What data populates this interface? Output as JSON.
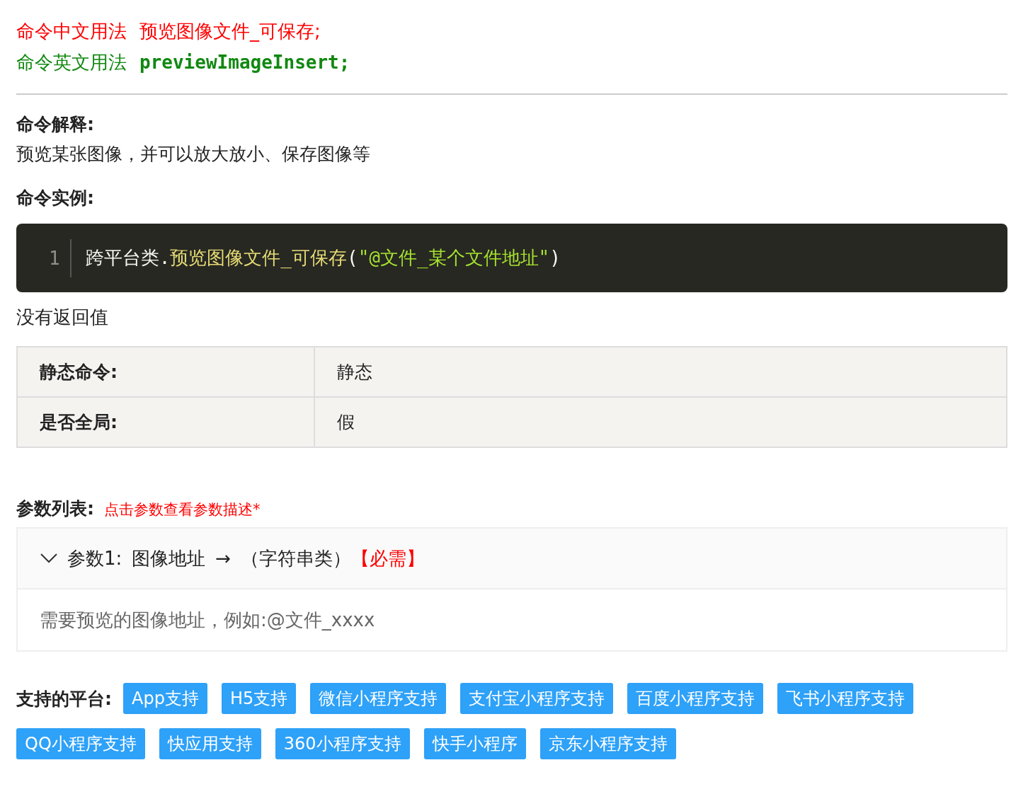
{
  "usage": {
    "chinese_label": "命令中文用法",
    "chinese_value": "预览图像文件_可保存;",
    "english_label": "命令英文用法",
    "english_value": "previewImageInsert;"
  },
  "explanation": {
    "heading": "命令解释:",
    "text": "预览某张图像，并可以放大放小、保存图像等"
  },
  "example": {
    "heading": "命令实例:",
    "line_number": "1",
    "tokens": [
      {
        "kind": "plain",
        "text": "跨平台类"
      },
      {
        "kind": "plain",
        "text": "."
      },
      {
        "kind": "method",
        "text": "预览图像文件_可保存"
      },
      {
        "kind": "plain",
        "text": "("
      },
      {
        "kind": "string",
        "text": "\"@文件_某个文件地址\""
      },
      {
        "kind": "plain",
        "text": ")"
      }
    ]
  },
  "return_text": "没有返回值",
  "properties": [
    {
      "label": "静态命令:",
      "value": "静态"
    },
    {
      "label": "是否全局:",
      "value": "假"
    }
  ],
  "parameters": {
    "heading": "参数列表:",
    "hint": "点击参数查看参数描述*",
    "items": [
      {
        "expanded": true,
        "prefix": "参数1:",
        "name": "图像地址",
        "arrow": "→",
        "type": "（字符串类）",
        "required": "【必需】",
        "description": "需要预览的图像地址，例如:@文件_xxxx"
      }
    ]
  },
  "platforms": {
    "heading": "支持的平台:",
    "tags": [
      "App支持",
      "H5支持",
      "微信小程序支持",
      "支付宝小程序支持",
      "百度小程序支持",
      "飞书小程序支持",
      "QQ小程序支持",
      "快应用支持",
      "360小程序支持",
      "快手小程序",
      "京东小程序支持"
    ]
  }
}
